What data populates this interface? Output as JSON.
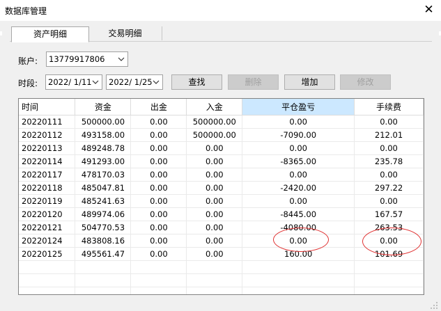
{
  "window": {
    "title": "数据库管理",
    "close_glyph": "✕"
  },
  "tabs": [
    {
      "label": "资产明细",
      "active": true
    },
    {
      "label": "交易明细",
      "active": false
    }
  ],
  "account": {
    "label": "账户:",
    "value": "13779917806"
  },
  "period": {
    "label": "时段:",
    "start": "2022/ 1/11",
    "end": "2022/ 1/25"
  },
  "buttons": {
    "search": "查找",
    "delete": "删除",
    "add": "增加",
    "edit": "修改"
  },
  "table": {
    "columns": [
      "时间",
      "资金",
      "出金",
      "入金",
      "平仓盈亏",
      "手续费"
    ],
    "rows": [
      [
        "20220111",
        "500000.00",
        "0.00",
        "500000.00",
        "0.00",
        "0.00"
      ],
      [
        "20220112",
        "493158.00",
        "0.00",
        "500000.00",
        "-7090.00",
        "212.01"
      ],
      [
        "20220113",
        "489248.78",
        "0.00",
        "0.00",
        "0.00",
        "0.00"
      ],
      [
        "20220114",
        "491293.00",
        "0.00",
        "0.00",
        "-8365.00",
        "235.78"
      ],
      [
        "20220117",
        "478170.03",
        "0.00",
        "0.00",
        "0.00",
        "0.00"
      ],
      [
        "20220118",
        "485047.81",
        "0.00",
        "0.00",
        "-2420.00",
        "297.22"
      ],
      [
        "20220119",
        "485241.63",
        "0.00",
        "0.00",
        "0.00",
        "0.00"
      ],
      [
        "20220120",
        "489974.06",
        "0.00",
        "0.00",
        "-8445.00",
        "167.57"
      ],
      [
        "20220121",
        "504770.53",
        "0.00",
        "0.00",
        "-4080.00",
        "263.53"
      ],
      [
        "20220124",
        "483808.16",
        "0.00",
        "0.00",
        "0.00",
        "0.00"
      ],
      [
        "20220125",
        "495561.47",
        "0.00",
        "0.00",
        "160.00",
        "101.69"
      ]
    ]
  },
  "colors": {
    "highlight": "#e03030",
    "selected_header": "#cce8ff",
    "dialog_bg": "#f0f0f0"
  }
}
